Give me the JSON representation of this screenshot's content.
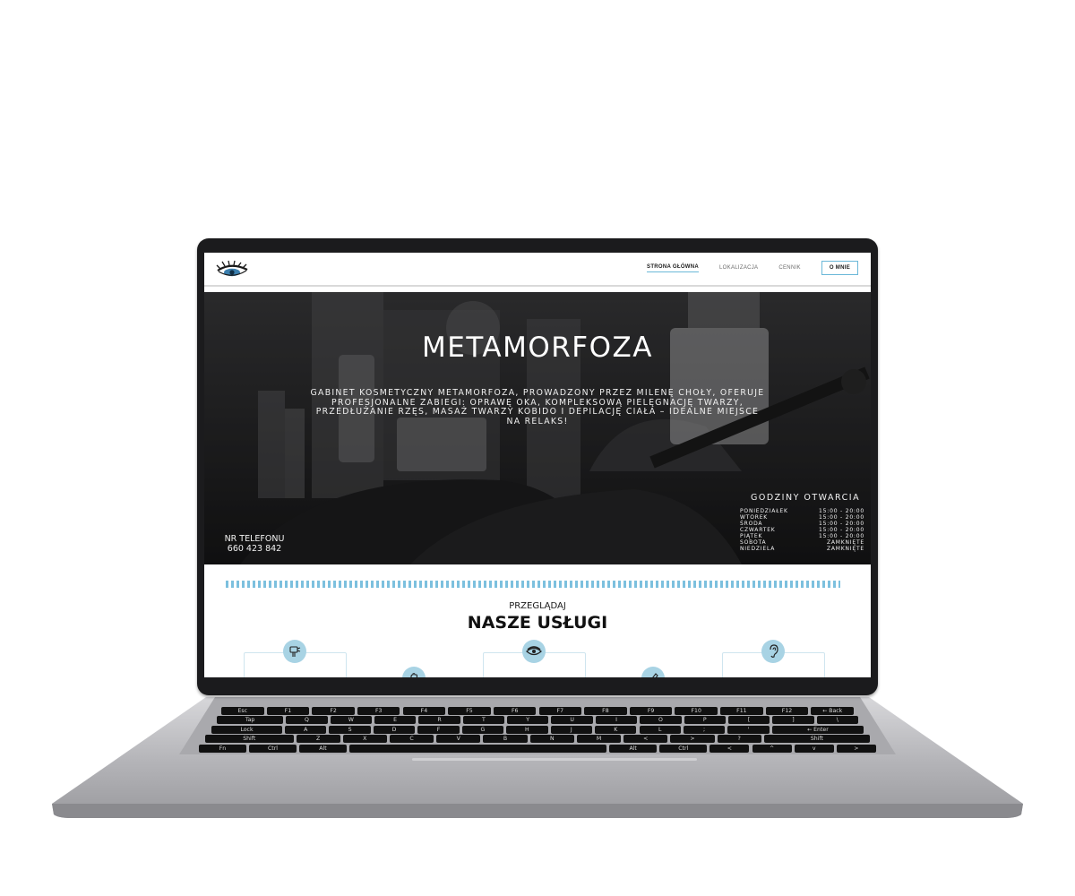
{
  "nav": {
    "items": [
      {
        "label": "STRONA GŁÓWNA",
        "state": "active"
      },
      {
        "label": "LOKALIZACJA",
        "state": "normal"
      },
      {
        "label": "CENNIK",
        "state": "normal"
      },
      {
        "label": "O MNIE",
        "state": "boxed"
      }
    ]
  },
  "hero": {
    "title": "METAMORFOZA",
    "description": "GABINET KOSMETYCZNY METAMORFOZA, PROWADZONY PRZEZ MILENĘ CHOŁY, OFERUJE PROFESJONALNE ZABIEGI: OPRAWĘ OKA, KOMPLEKSOWĄ PIELĘGNACJĘ TWARZY, PRZEDŁUŻANIE RZĘS, MASAŻ TWARZY KOBIDO I DEPILACJĘ CIAŁA – IDEALNE MIEJSCE NA RELAKS!",
    "phone_label": "NR TELEFONU",
    "phone_number": "660 423 842"
  },
  "hours": {
    "title": "GODZINY OTWARCIA",
    "rows": [
      {
        "day": "PONIEDZIAŁEK",
        "time": "15:00 - 20:00"
      },
      {
        "day": "WTOREK",
        "time": "15:00 - 20:00"
      },
      {
        "day": "ŚRODA",
        "time": "15:00 - 20:00"
      },
      {
        "day": "CZWARTEK",
        "time": "15:00 - 20:00"
      },
      {
        "day": "PIĄTEK",
        "time": "15:00 - 20:00"
      },
      {
        "day": "SOBOTA",
        "time": "ZAMKNIĘTE"
      },
      {
        "day": "NIEDZIELA",
        "time": "ZAMKNIĘTE"
      }
    ]
  },
  "services": {
    "browse_label": "PRZEGLĄDAJ",
    "title": "NASZE USŁUGI",
    "icons": [
      "massage-device-icon",
      "hand-icon",
      "eye-icon",
      "pen-icon",
      "ear-icon"
    ]
  },
  "colors": {
    "accent": "#7cc0de",
    "badge": "#a8d3e4",
    "hero_bg": "#2b2b2d",
    "laptop_body": "#b5b5b9",
    "bezel": "#1b1b1d"
  },
  "keyboard": {
    "rows": [
      [
        "Esc",
        "F1",
        "F2",
        "F3",
        "F4",
        "F5",
        "F6",
        "F7",
        "F8",
        "F9",
        "F10",
        "F11",
        "F12",
        "← Back"
      ],
      [
        "Tap",
        "Q",
        "W",
        "E",
        "R",
        "T",
        "Y",
        "U",
        "I",
        "O",
        "P",
        "[",
        "]",
        "\\"
      ],
      [
        "Lock",
        "A",
        "S",
        "D",
        "F",
        "G",
        "H",
        "J",
        "K",
        "L",
        ";",
        "'",
        "← Enter"
      ],
      [
        "Shift",
        "Z",
        "X",
        "C",
        "V",
        "B",
        "N",
        "M",
        "<",
        ">",
        "?",
        "Shift"
      ],
      [
        "Fn",
        "Ctrl",
        "Alt",
        "",
        "Alt",
        "Ctrl",
        "<",
        "^",
        "v",
        ">"
      ]
    ]
  }
}
